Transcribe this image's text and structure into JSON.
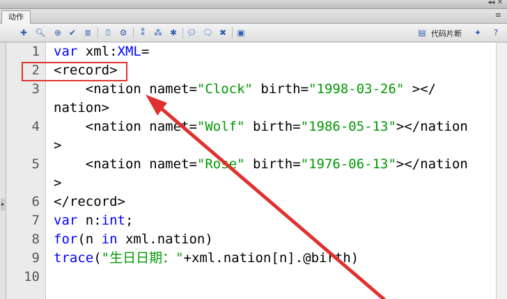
{
  "panel": {
    "tab_label": "动作",
    "snippet_label": "代码片断",
    "tab_menu_glyph": "≡",
    "title_controls": "◂◂ ✕"
  },
  "toolbar": {
    "icons": [
      "add-statement-icon",
      "find-icon",
      "target-icon",
      "check-syntax-icon",
      "auto-format-icon",
      "code-hint-icon",
      "debug-icon",
      "collapse-braces-icon",
      "collapse-selection-icon",
      "expand-all-icon",
      "apply-block-comment-icon",
      "apply-line-comment-icon",
      "remove-comment-icon",
      "script-assist-icon",
      "code-snippets-icon",
      "magic-wand-icon",
      "help-icon"
    ]
  },
  "editor": {
    "line_numbers": [
      "1",
      "2",
      "3",
      "",
      "4",
      "",
      "5",
      "",
      "6",
      "7",
      "8",
      "9",
      "10"
    ],
    "lines": [
      {
        "segments": [
          {
            "t": "var",
            "c": "kw"
          },
          {
            "t": " xml:",
            "c": ""
          },
          {
            "t": "XML",
            "c": "ty"
          },
          {
            "t": "=",
            "c": ""
          }
        ]
      },
      {
        "segments": [
          {
            "t": "<record>",
            "c": ""
          }
        ]
      },
      {
        "segments": [
          {
            "t": "    <nation namet=",
            "c": ""
          },
          {
            "t": "\"Clock\"",
            "c": "str"
          },
          {
            "t": " birth=",
            "c": ""
          },
          {
            "t": "\"1998-03-26\"",
            "c": "str"
          },
          {
            "t": " ></",
            "c": ""
          }
        ]
      },
      {
        "segments": [
          {
            "t": "nation>",
            "c": ""
          }
        ]
      },
      {
        "segments": [
          {
            "t": "    <nation namet=",
            "c": ""
          },
          {
            "t": "\"Wolf\"",
            "c": "str"
          },
          {
            "t": " birth=",
            "c": ""
          },
          {
            "t": "\"1986-05-13\"",
            "c": "str"
          },
          {
            "t": "></nation",
            "c": ""
          }
        ]
      },
      {
        "segments": [
          {
            "t": ">",
            "c": ""
          }
        ]
      },
      {
        "segments": [
          {
            "t": "    <nation namet=",
            "c": ""
          },
          {
            "t": "\"Rose\"",
            "c": "str"
          },
          {
            "t": " birth=",
            "c": ""
          },
          {
            "t": "\"1976-06-13\"",
            "c": "str"
          },
          {
            "t": "></nation",
            "c": ""
          }
        ]
      },
      {
        "segments": [
          {
            "t": ">",
            "c": ""
          }
        ]
      },
      {
        "segments": [
          {
            "t": "</record>",
            "c": ""
          }
        ]
      },
      {
        "segments": [
          {
            "t": "var",
            "c": "kw"
          },
          {
            "t": " n:",
            "c": ""
          },
          {
            "t": "int",
            "c": "ty"
          },
          {
            "t": ";",
            "c": ""
          }
        ]
      },
      {
        "segments": [
          {
            "t": "for",
            "c": "kw"
          },
          {
            "t": "(n ",
            "c": ""
          },
          {
            "t": "in",
            "c": "kw"
          },
          {
            "t": " xml.nation)",
            "c": ""
          }
        ]
      },
      {
        "segments": [
          {
            "t": "trace",
            "c": "fn"
          },
          {
            "t": "(",
            "c": ""
          },
          {
            "t": "\"生日日期：\"",
            "c": "str"
          },
          {
            "t": "+xml.nation[n].@birth)",
            "c": ""
          }
        ]
      },
      {
        "segments": []
      }
    ]
  },
  "annotation": {
    "color": "#e0312f"
  }
}
